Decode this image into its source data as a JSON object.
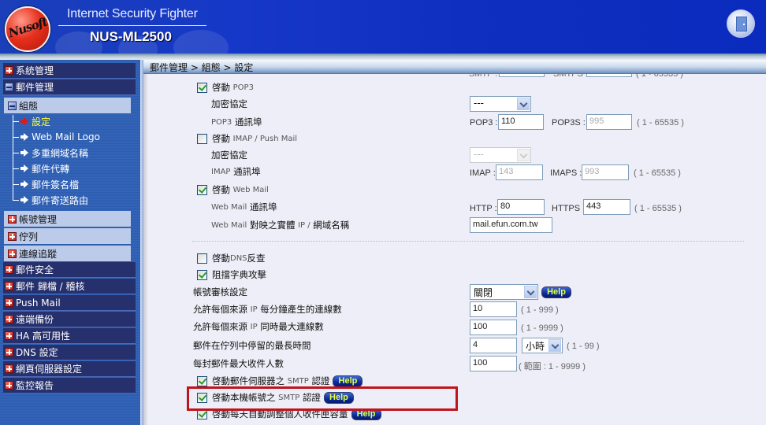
{
  "header": {
    "logo_text": "Nusoft",
    "app_title": "Internet Security Fighter",
    "model_name": "NUS-ML2500",
    "logout_icon": "door-exit-icon"
  },
  "sidebar": {
    "top_items": [
      {
        "label": "系統管理",
        "state": "collapsed"
      },
      {
        "label": "郵件管理",
        "state": "expanded"
      }
    ],
    "mail_submenu": {
      "group_label": "組態",
      "group_state": "expanded",
      "leaves": [
        {
          "label": "設定",
          "active": true
        },
        {
          "label": "Web Mail Logo",
          "active": false
        },
        {
          "label": "多重網域名稱",
          "active": false
        },
        {
          "label": "郵件代轉",
          "active": false
        },
        {
          "label": "郵件簽名檔",
          "active": false
        },
        {
          "label": "郵件寄送路由",
          "active": false
        }
      ],
      "other_groups": [
        {
          "label": "帳號管理"
        },
        {
          "label": "佇列"
        },
        {
          "label": "連線追蹤"
        }
      ]
    },
    "bottom_items": [
      {
        "label": "郵件安全"
      },
      {
        "label": "郵件 歸檔 / 稽核"
      },
      {
        "label": "Push Mail"
      },
      {
        "label": "遠端備份"
      },
      {
        "label": "HA 高可用性"
      },
      {
        "label": "DNS 設定"
      },
      {
        "label": "網頁伺服器設定"
      },
      {
        "label": "監控報告"
      }
    ]
  },
  "breadcrumb": "郵件管理 > 組態 > 設定",
  "form": {
    "smtp_partial": {
      "label1": "SMTP :",
      "label2": "SMTPS :",
      "range": "( 1 - 65535 )"
    },
    "pop3": {
      "enable_prefix": "啓動",
      "enable_suffix": "POP3",
      "checked": true,
      "encrypt_label": "加密協定",
      "encrypt_value": "---",
      "port_label_prefix": "POP3",
      "port_label_suffix": "通訊埠",
      "port1_label": "POP3 :",
      "port1_value": "110",
      "port2_label": "POP3S :",
      "port2_value": "995",
      "range": "( 1 - 65535 )"
    },
    "imap": {
      "enable_prefix": "啓動",
      "enable_suffix": "IMAP / Push Mail",
      "checked": false,
      "encrypt_label": "加密協定",
      "encrypt_value": "---",
      "port_label_prefix": "IMAP",
      "port_label_suffix": "通訊埠",
      "port1_label": "IMAP :",
      "port1_value": "143",
      "port2_label": "IMAPS :",
      "port2_value": "993",
      "range": "( 1 - 65535 )"
    },
    "webmail": {
      "enable_prefix": "啓動",
      "enable_suffix": "Web Mail",
      "checked": true,
      "port_label_prefix": "Web Mail",
      "port_label_suffix": "通訊埠",
      "port1_label": "HTTP :",
      "port1_value": "80",
      "port2_label": "HTTPS :",
      "port2_value": "443",
      "range": "( 1 - 65535 )",
      "host_label_prefix": "Web Mail",
      "host_label_mid": "對映之實體",
      "host_label_ip": "IP /",
      "host_label_suffix": "網域名稱",
      "host_value": "mail.efun.com.tw"
    },
    "dns_reverse": {
      "label_prefix": "啓動",
      "label_en": "DNS",
      "label_suffix": "反查",
      "checked": false
    },
    "dictionary_block": {
      "label": "阻擋字典攻擊",
      "checked": true
    },
    "account_audit": {
      "label": "帳號審核設定",
      "value": "關閉",
      "help": "Help"
    },
    "conn_per_minute": {
      "label_a": "允許每個來源",
      "label_ip": "IP",
      "label_b": "每分鐘產生的連線數",
      "value": "10",
      "range": "( 1 - 999 )"
    },
    "max_concurrent": {
      "label_a": "允許每個來源",
      "label_ip": "IP",
      "label_b": "同時最大連線數",
      "value": "100",
      "range": "( 1 - 9999 )"
    },
    "queue_time": {
      "label": "郵件在佇列中停留的最長時間",
      "value": "4",
      "unit": "小時",
      "range": "( 1 - 99 )"
    },
    "max_recipients": {
      "label": "每封郵件最大收件人數",
      "value": "100",
      "range": "( 範圍 : 1 - 9999 )"
    },
    "smtp_auth_server": {
      "label_a": "啓動郵件伺服器之",
      "label_en": "SMTP",
      "label_b": "認證",
      "checked": true,
      "help": "Help"
    },
    "smtp_auth_local": {
      "label_a": "啓動本機帳號之",
      "label_en": "SMTP",
      "label_b": "認證",
      "checked": true,
      "help": "Help",
      "highlighted": true
    },
    "auto_quota": {
      "label": "啓動每天自動調整個人收件匣容量",
      "checked": true,
      "help": "Help"
    }
  },
  "colors": {
    "header_blue": "#1638c8",
    "nav_dark": "#26306c",
    "nav_sub": "#bccbea",
    "active_leaf": "#ffff33",
    "highlight_red": "#c0141c",
    "help_text": "#eaff40"
  }
}
